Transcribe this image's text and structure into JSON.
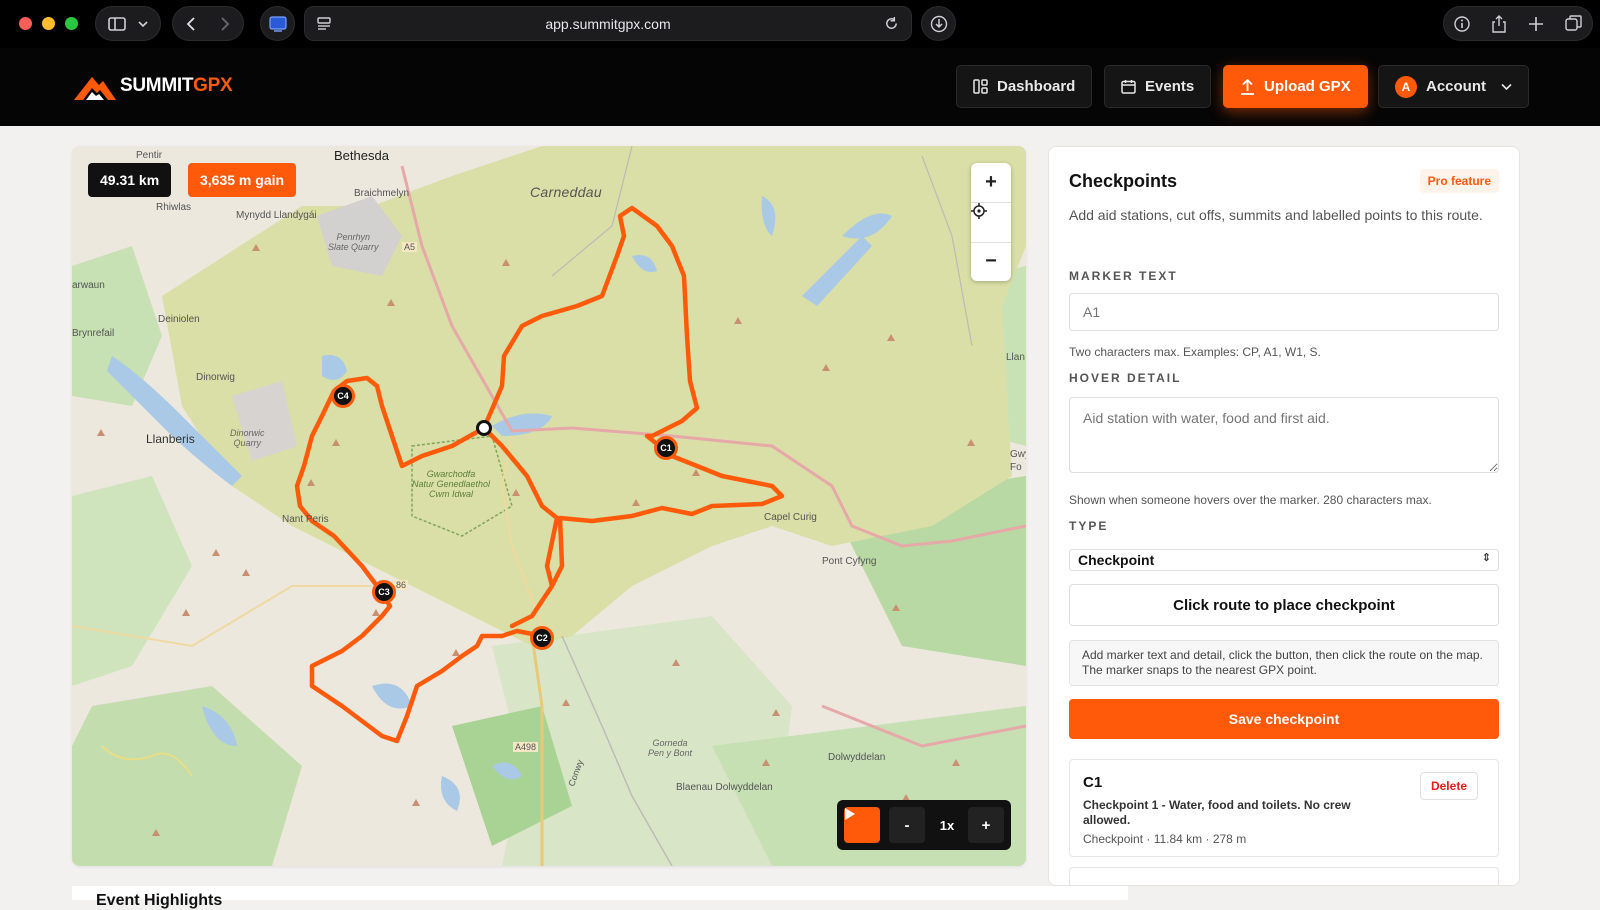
{
  "browser": {
    "url": "app.summitgpx.com"
  },
  "header": {
    "logo_primary": "SUMMIT",
    "logo_accent": "GPX",
    "nav": {
      "dashboard": "Dashboard",
      "events": "Events",
      "upload": "Upload GPX",
      "account": "Account",
      "avatar_initial": "A"
    }
  },
  "map": {
    "distance": "49.31 km",
    "elevation_gain": "3,635 m gain",
    "zoom_in": "+",
    "zoom_out": "−",
    "playback": {
      "slower": "-",
      "speed": "1x",
      "faster": "+"
    },
    "markers": [
      "C1",
      "C2",
      "C3",
      "C4"
    ],
    "labels": {
      "bethesda": "Bethesda",
      "pentir": "Pentir",
      "rhiwlas": "Rhiwlas",
      "braichmelyn": "Braichmelyn",
      "mynydd": "Mynydd Llandygái",
      "penrhyn": "Penrhyn\nSlate Quarry",
      "a5": "A5",
      "carneddau": "Carneddau",
      "arwaun": "arwaun",
      "deiniolen": "Deiniolen",
      "brynrefail": "Brynrefail",
      "dinorwig": "Dinorwig",
      "llanberis": "Llanberis",
      "dinorwic": "Dinorwic\nQuarry",
      "gwarchodfa": "Gwarchodfa\nNatur Genedlaethol\nCwm Idwal",
      "nant_peris": "Nant Peris",
      "capel_curig": "Capel Curig",
      "pont_cyfyng": "Pont Cyfyng",
      "llan": "Llan",
      "gwy": "Gwy\nFo",
      "a86": "86",
      "a498": "A498",
      "gorneda": "Gorneda\nPen y Bont",
      "conwy": "Conwy",
      "blaenau": "Blaenau Dolwyddelan",
      "dolwyddelan": "Dolwyddelan"
    }
  },
  "panel": {
    "title": "Checkpoints",
    "badge": "Pro feature",
    "description": "Add aid stations, cut offs, summits and labelled points to this route.",
    "marker_text_label": "MARKER TEXT",
    "marker_text_placeholder": "A1",
    "marker_text_hint": "Two characters max. Examples: CP, A1, W1, S.",
    "hover_label": "HOVER DETAIL",
    "hover_placeholder": "Aid station with water, food and first aid.",
    "hover_hint": "Shown when someone hovers over the marker. 280 characters max.",
    "type_label": "TYPE",
    "type_value": "Checkpoint",
    "place_button": "Click route to place checkpoint",
    "info": "Add marker text and detail, click the button, then click the route on the map. The marker snaps to the nearest GPX point.",
    "save_button": "Save checkpoint",
    "checkpoints": [
      {
        "code": "C1",
        "description": "Checkpoint 1 - Water, food and toilets. No crew allowed.",
        "meta": "Checkpoint · 11.84 km · 278 m",
        "delete": "Delete"
      }
    ]
  },
  "footer": {
    "partial_heading": "Event Highlights"
  },
  "colors": {
    "accent": "#ff5a0a",
    "route": "#ff5a0a",
    "park": "#d9dfa6"
  }
}
